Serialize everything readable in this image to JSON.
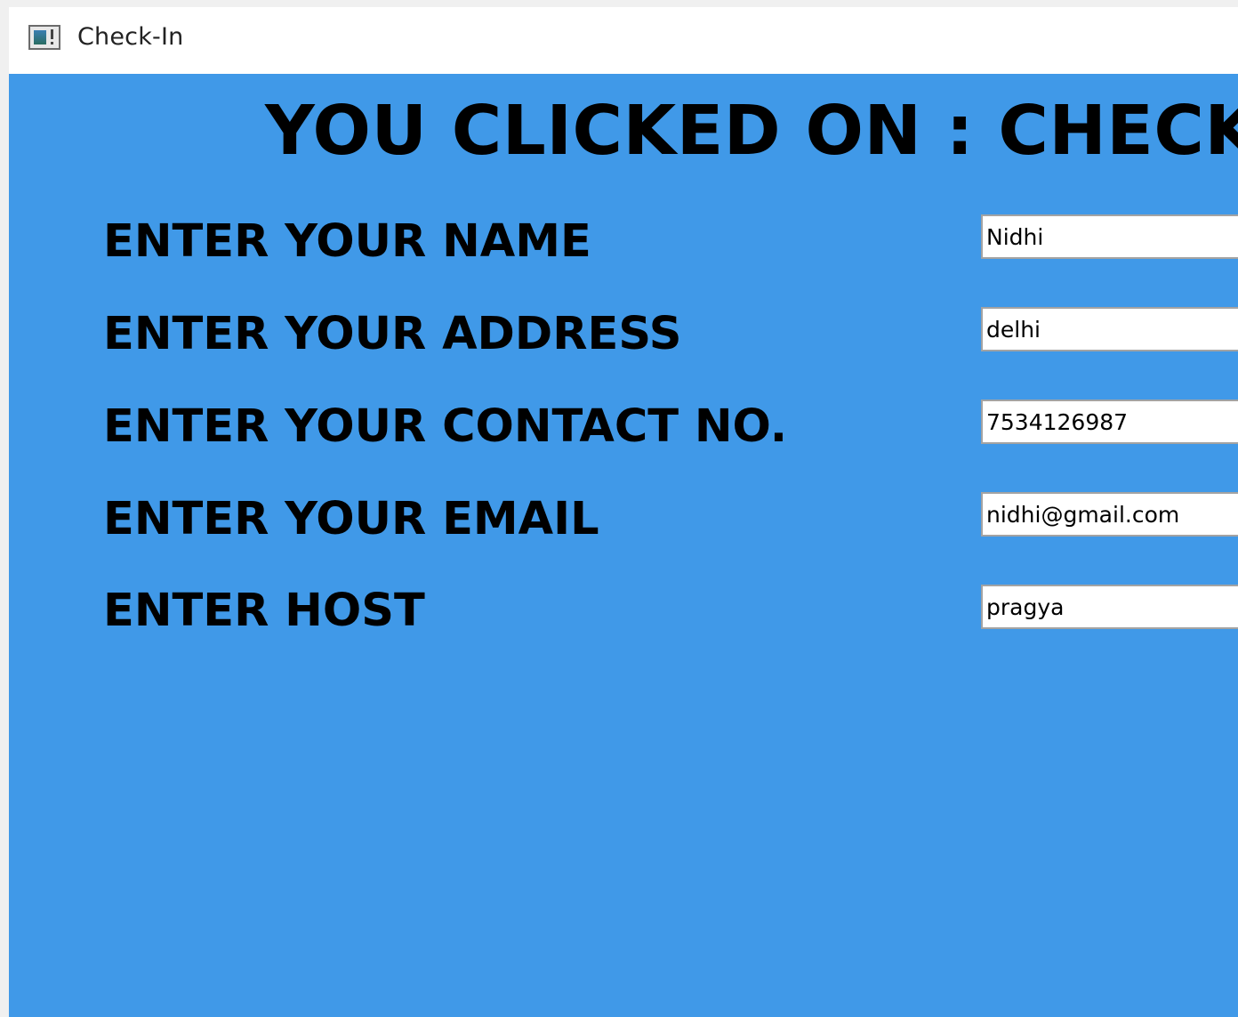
{
  "window": {
    "title": "Check-In",
    "icon": "console-window-icon"
  },
  "heading": "YOU CLICKED ON : CHECK",
  "fields": [
    {
      "label": "ENTER YOUR NAME",
      "value": "Nidhi"
    },
    {
      "label": "ENTER YOUR ADDRESS",
      "value": "delhi"
    },
    {
      "label": "ENTER YOUR CONTACT NO.",
      "value": "7534126987"
    },
    {
      "label": "ENTER YOUR EMAIL",
      "value": "nidhi@gmail.com"
    },
    {
      "label": "ENTER HOST",
      "value": "pragya"
    }
  ],
  "colors": {
    "background": "#4099e8",
    "text": "#000000",
    "input_border": "#a3a3a3"
  }
}
